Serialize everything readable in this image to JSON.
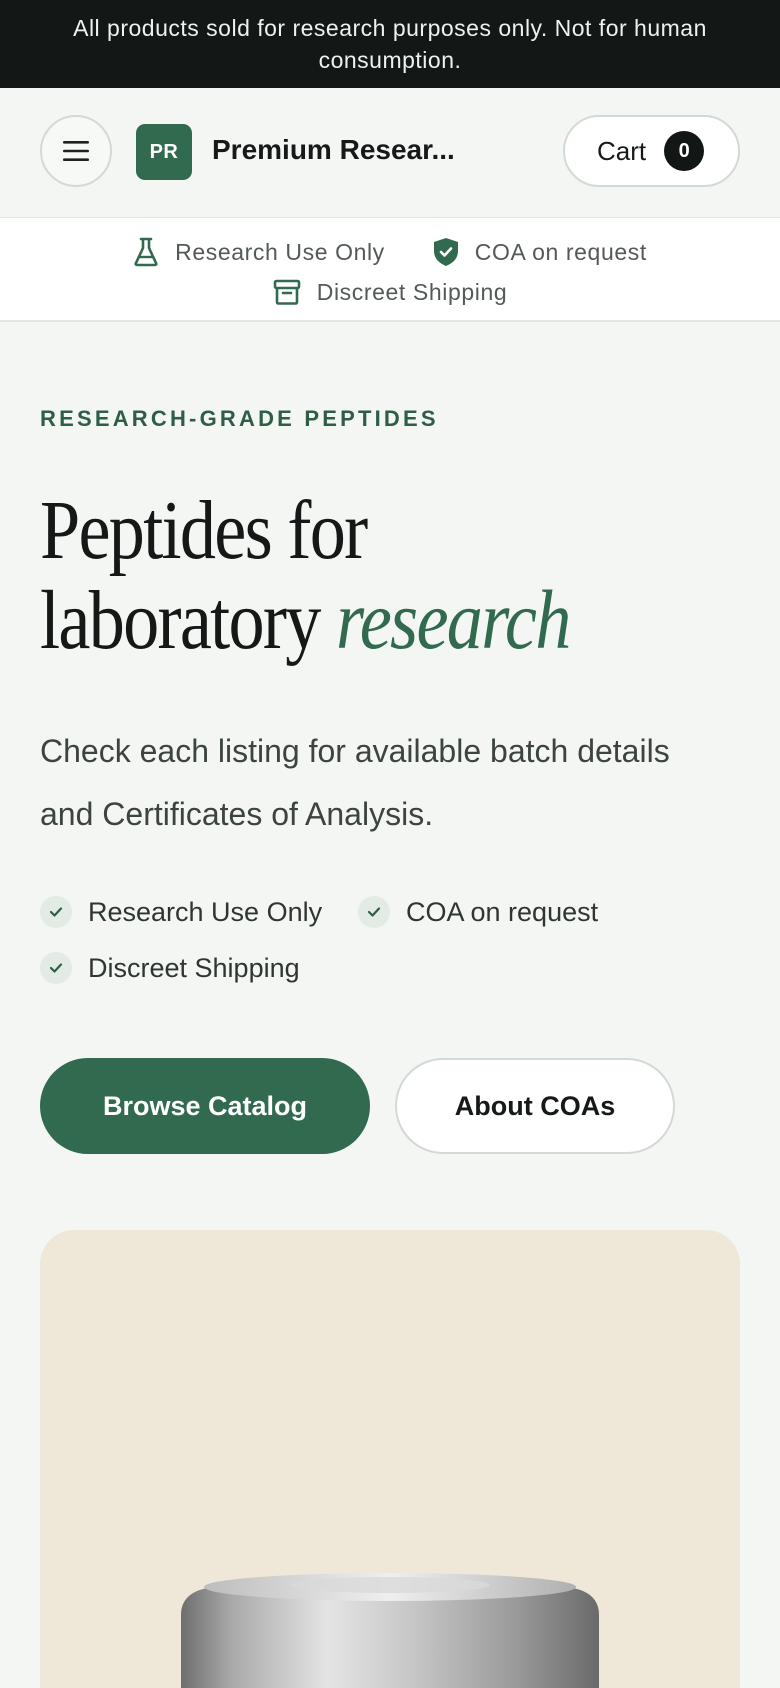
{
  "announcement": {
    "text": "All products sold for research purposes only. Not for human consumption."
  },
  "header": {
    "menu_icon": "hamburger-menu-icon",
    "logo_initials": "PR",
    "brand_name": "Premium Resear...",
    "cart_label": "Cart",
    "cart_count": "0"
  },
  "trust_bar": {
    "items": [
      {
        "icon": "flask-icon",
        "label": "Research Use Only"
      },
      {
        "icon": "shield-check-icon",
        "label": "COA on request"
      },
      {
        "icon": "archive-box-icon",
        "label": "Discreet Shipping"
      }
    ]
  },
  "hero": {
    "eyebrow": "RESEARCH-GRADE PEPTIDES",
    "headline_line1": "Peptides for",
    "headline_line2": "laboratory",
    "headline_accent": "research",
    "subtext": "Check each listing for available batch details and Certificates of Analysis.",
    "checks": [
      {
        "icon": "check-icon",
        "label": "Research Use Only"
      },
      {
        "icon": "check-icon",
        "label": "COA on request"
      },
      {
        "icon": "check-icon",
        "label": "Discreet Shipping"
      }
    ],
    "primary_button": "Browse Catalog",
    "secondary_button": "About COAs"
  },
  "colors": {
    "brand_green": "#316a4e",
    "announcement_bg": "#131816",
    "page_bg": "#f4f6f4",
    "card_bg": "#efe8d8"
  }
}
